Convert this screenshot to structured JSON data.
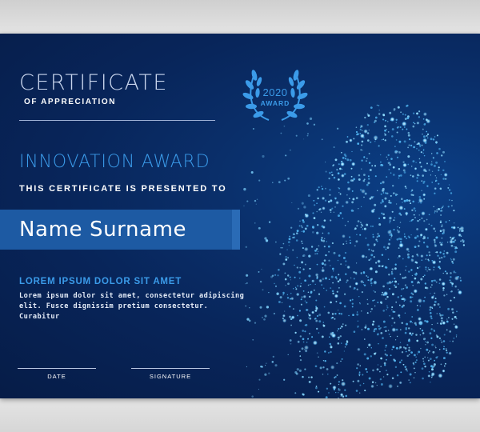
{
  "certificate": {
    "title": "CERTIFICATE",
    "subtitle": "OF APPRECIATION",
    "badge": {
      "year": "2020",
      "label": "AWARD"
    },
    "award_title": "INNOVATION AWARD",
    "presented_text": "THIS CERTIFICATE IS PRESENTED TO",
    "recipient_name": "Name Surname",
    "heading": "LOREM IPSUM DOLOR SIT AMET",
    "body_lines": [
      "Lorem ipsum dolor sit amet, consectetur adipiscing",
      "elit. Fusce dignissim pretium consectetur. Curabitur"
    ],
    "signatures": {
      "date_label": "DATE",
      "signature_label": "SIGNATURE"
    }
  },
  "colors": {
    "background": "#082459",
    "accent": "#3b9be9",
    "name_bar": "#1d5aa3",
    "particles": "#7fd4ff"
  },
  "icons": [
    "laurel-wreath-icon",
    "particle-face-illustration"
  ]
}
